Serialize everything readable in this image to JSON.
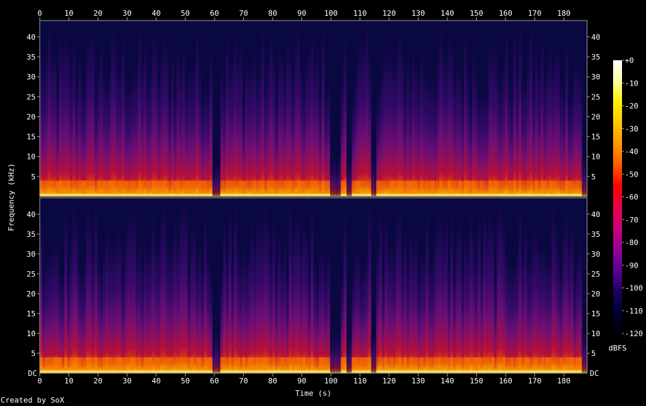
{
  "credit": "Created by SoX",
  "colors": {
    "background": "#000000",
    "text": "#ffffff",
    "frame": "#9b9b9b"
  },
  "chart_data": {
    "type": "heatmap",
    "subtype": "spectrogram",
    "title": "",
    "xlabel": "Time (s)",
    "ylabel": "Frequency (kHz)",
    "xlim": [
      0,
      188
    ],
    "ylim": [
      0,
      44.1
    ],
    "x_ticks": [
      0,
      10,
      20,
      30,
      40,
      50,
      60,
      70,
      80,
      90,
      100,
      110,
      120,
      130,
      140,
      150,
      160,
      170,
      180
    ],
    "y_ticks_left": [
      "40",
      "35",
      "30",
      "25",
      "20",
      "15",
      "10",
      "5"
    ],
    "y_ticks_right": [
      "40",
      "35",
      "30",
      "25",
      "20",
      "15",
      "10",
      "5"
    ],
    "y_bottom_label": "DC",
    "channels": 2,
    "colorbar": {
      "label": "dBFS",
      "ticks": [
        "+0",
        "-10",
        "-20",
        "-30",
        "-40",
        "-50",
        "-60",
        "-70",
        "-80",
        "-90",
        "-100",
        "-110",
        "-120"
      ],
      "range": [
        -120,
        0
      ],
      "palette": [
        "#ffffff",
        "#ffffa0",
        "#fff000",
        "#ffc800",
        "#ff9600",
        "#ff5a00",
        "#ff0000",
        "#e6004a",
        "#c8007a",
        "#960096",
        "#5a0096",
        "#1e0064",
        "#000032",
        "#000000"
      ]
    },
    "quiet_regions_s": [
      [
        59,
        62
      ],
      [
        100,
        103
      ],
      [
        105,
        107
      ],
      [
        114,
        116
      ],
      [
        186,
        188
      ]
    ],
    "loud_band_khz": [
      0,
      4
    ]
  }
}
